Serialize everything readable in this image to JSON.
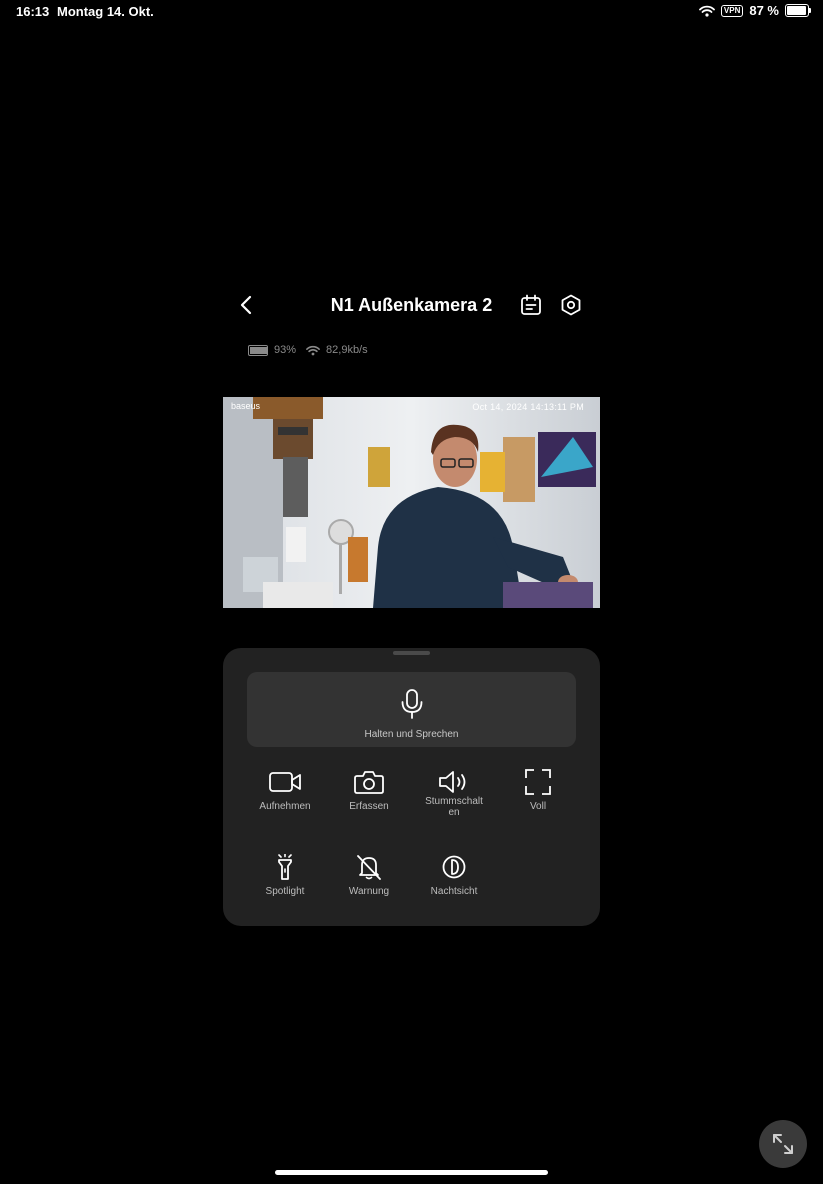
{
  "status_bar": {
    "time": "16:13",
    "date": "Montag 14. Okt.",
    "vpn": "VPN",
    "battery_text": "87 %",
    "battery_level": 0.87
  },
  "header": {
    "title": "N1 Außenkamera 2",
    "icons": {
      "back": "chevron-left-icon",
      "calendar": "calendar-icon",
      "settings": "hexagon-gear-icon"
    }
  },
  "device_info": {
    "battery": "93%",
    "battery_level": 0.93,
    "bitrate": "82,9kb/s"
  },
  "live_view": {
    "brand": "baseus",
    "timestamp": "Oct 14, 2024  14:13:11 PM"
  },
  "controls": {
    "talk_label": "Halten und Sprechen",
    "buttons": [
      {
        "label": "Aufnehmen",
        "icon": "video-camera-icon"
      },
      {
        "label": "Erfassen",
        "icon": "camera-icon"
      },
      {
        "label": "Stummschalten",
        "icon": "speaker-icon"
      },
      {
        "label": "Voll",
        "icon": "fullscreen-icon"
      },
      {
        "label": "Spotlight",
        "icon": "flashlight-icon"
      },
      {
        "label": "Warnung",
        "icon": "bell-off-icon"
      },
      {
        "label": "Nachtsicht",
        "icon": "night-vision-icon"
      }
    ]
  },
  "colors": {
    "background": "#000000",
    "panel": "#222222",
    "talk_button": "#333333",
    "secondary_text": "#8a8a8a"
  }
}
